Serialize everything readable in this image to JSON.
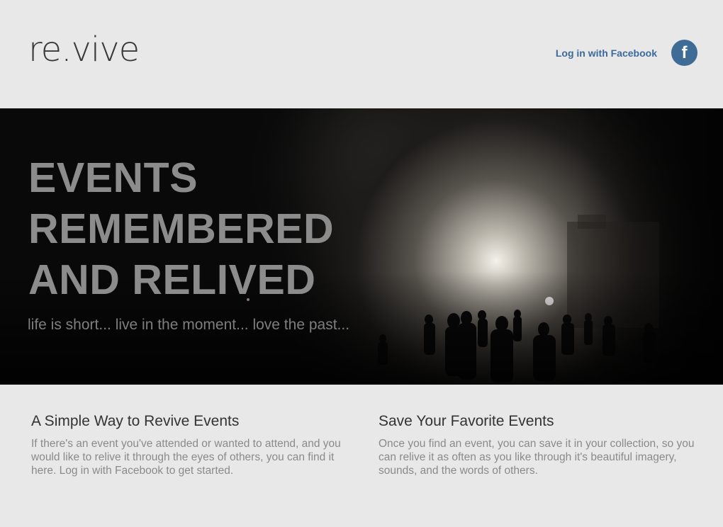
{
  "header": {
    "logo": "re.vive",
    "login_label": "Log in with Facebook",
    "fb_glyph": "f",
    "fb_icon": "facebook-icon"
  },
  "hero": {
    "title_lines": [
      "EVENTS",
      "REMEMBERED",
      "AND RELIVED"
    ],
    "tagline": "life is short... live in the moment... love the past..."
  },
  "features": [
    {
      "title": "A Simple Way to Revive Events",
      "text": "If there's an event you've attended or wanted to attend, and you would like to relive it through the eyes of others, you can find it here. Log in with Facebook to get started."
    },
    {
      "title": "Save Your Favorite Events",
      "text": "Once you find an event, you can save it in your collection, so you can relive it as often as you like through it's beautiful imagery, sounds, and the words of others."
    }
  ],
  "colors": {
    "background": "#e8e8e8",
    "brand_blue": "#3b6a9a",
    "facebook_circle": "#3f6b97",
    "hero_text": "#8c8c8c"
  }
}
